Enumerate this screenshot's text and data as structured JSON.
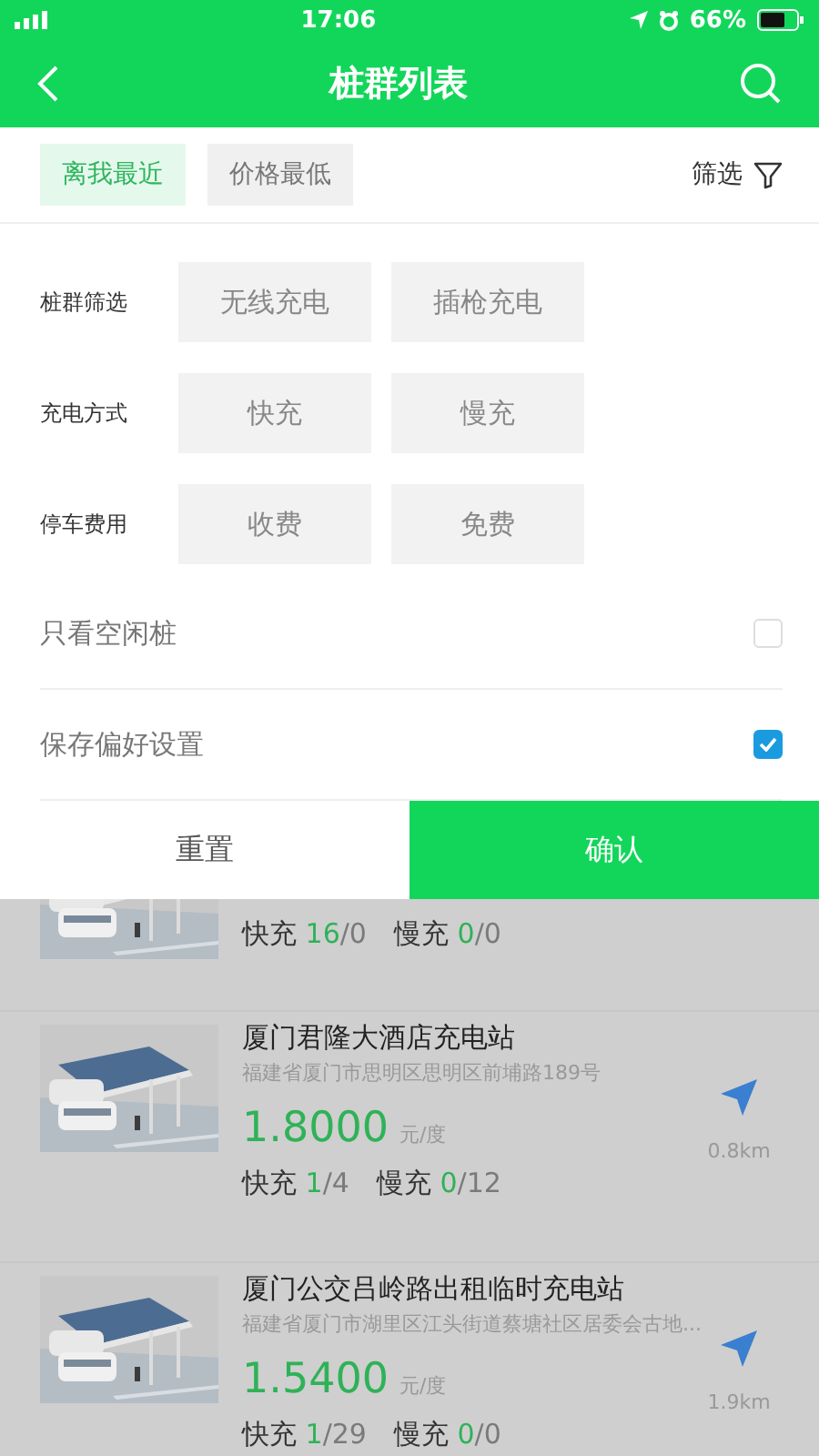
{
  "status_bar": {
    "time": "17:06",
    "battery": "66%"
  },
  "header": {
    "title": "桩群列表"
  },
  "sort_tabs": [
    {
      "label": "离我最近",
      "selected": true
    },
    {
      "label": "价格最低",
      "selected": false
    }
  ],
  "filter_button": "筛选",
  "filter_groups": [
    {
      "label": "桩群筛选",
      "options": [
        {
          "label": "无线充电",
          "selected": false
        },
        {
          "label": "插枪充电",
          "selected": false
        }
      ]
    },
    {
      "label": "充电方式",
      "options": [
        {
          "label": "快充",
          "selected": false
        },
        {
          "label": "慢充",
          "selected": false
        }
      ]
    },
    {
      "label": "停车费用",
      "options": [
        {
          "label": "收费",
          "selected": false
        },
        {
          "label": "免费",
          "selected": false
        }
      ]
    }
  ],
  "toggles": [
    {
      "label": "只看空闲桩",
      "checked": false
    },
    {
      "label": "保存偏好设置",
      "checked": true
    }
  ],
  "actions": {
    "reset": "重置",
    "confirm": "确认"
  },
  "stations": [
    {
      "kind": "partial",
      "fast_label": "快充",
      "fast_free": "16",
      "fast_total": "/0",
      "slow_label": "慢充",
      "slow_free": "0",
      "slow_total": "/0"
    },
    {
      "kind": "full",
      "name": "厦门君隆大酒店充电站",
      "address": "福建省厦门市思明区思明区前埔路189号",
      "price": "1.8000",
      "unit": "元/度",
      "distance": "0.8km",
      "fast_label": "快充",
      "fast_free": "1",
      "fast_total": "/4",
      "slow_label": "慢充",
      "slow_free": "0",
      "slow_total": "/12"
    },
    {
      "kind": "full",
      "name": "厦门公交吕岭路出租临时充电站",
      "address": "福建省厦门市湖里区江头街道蔡塘社区居委会古地...",
      "price": "1.5400",
      "unit": "元/度",
      "distance": "1.9km",
      "fast_label": "快充",
      "fast_free": "1",
      "fast_total": "/29",
      "slow_label": "慢充",
      "slow_free": "0",
      "slow_total": "/0"
    }
  ]
}
